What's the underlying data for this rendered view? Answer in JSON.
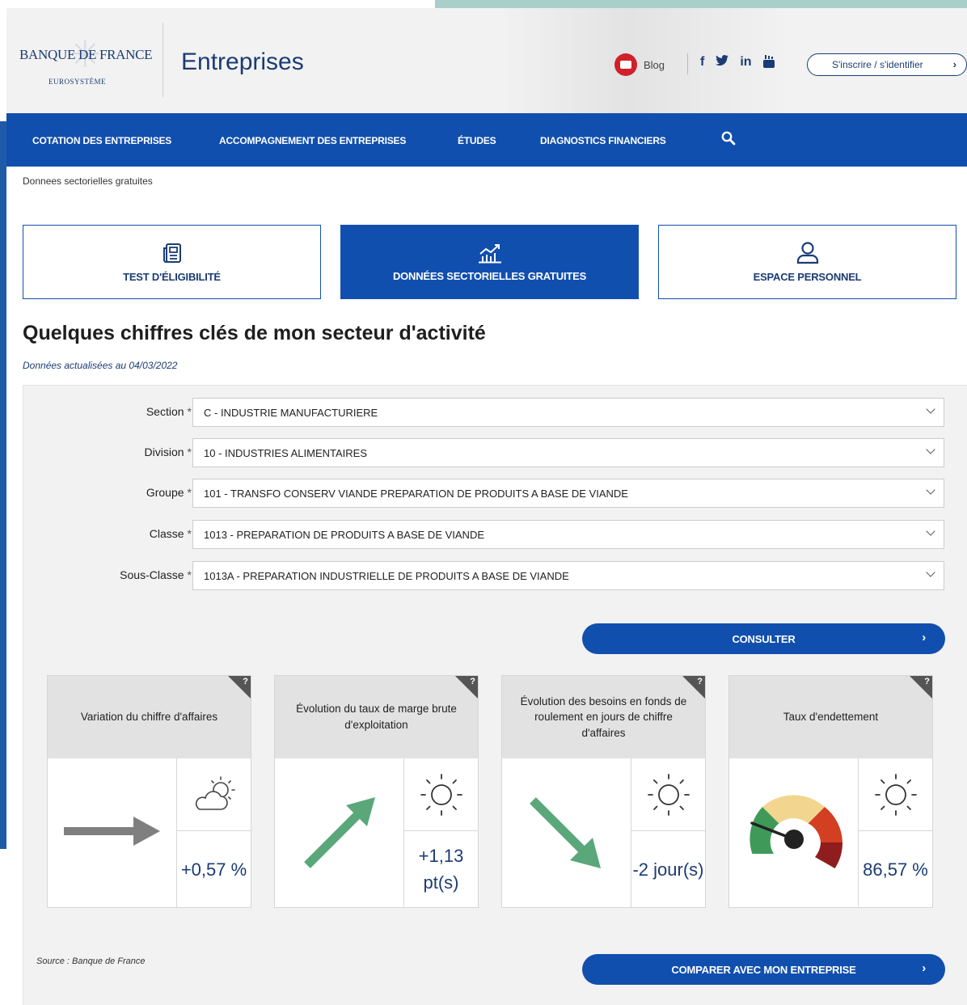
{
  "header": {
    "logo_main": "BANQUE DE FRANCE",
    "logo_sub": "EUROSYSTÈME",
    "site_title": "Entreprises",
    "blog_label": "Blog",
    "social": [
      "f",
      "y",
      "in",
      "yt"
    ],
    "login_label": "S'inscrire / s'identifier"
  },
  "nav": {
    "items": [
      "COTATION DES ENTREPRISES",
      "ACCOMPAGNEMENT DES ENTREPRISES",
      "ÉTUDES",
      "DIAGNOSTICS FINANCIERS"
    ]
  },
  "breadcrumb": "Donnees sectorielles gratuites",
  "tabs": [
    {
      "label": "TEST D'ÉLIGIBILITÉ",
      "icon": "document-icon",
      "active": false
    },
    {
      "label": "DONNÉES SECTORIELLES GRATUITES",
      "icon": "chart-icon",
      "active": true
    },
    {
      "label": "ESPACE PERSONNEL",
      "icon": "user-icon",
      "active": false
    }
  ],
  "page": {
    "title": "Quelques chiffres clés de mon secteur d'activité",
    "update_note": "Données actualisées au 04/03/2022"
  },
  "form": {
    "required_mark": "*",
    "fields": [
      {
        "label": "Section",
        "value": "C - INDUSTRIE MANUFACTURIERE"
      },
      {
        "label": "Division",
        "value": "10 - INDUSTRIES ALIMENTAIRES"
      },
      {
        "label": "Groupe",
        "value": "101 - TRANSFO CONSERV VIANDE PREPARATION DE PRODUITS A BASE DE VIANDE"
      },
      {
        "label": "Classe",
        "value": "1013 - PREPARATION DE PRODUITS A BASE DE VIANDE"
      },
      {
        "label": "Sous-Classe",
        "value": "1013A - PREPARATION INDUSTRIELLE DE PRODUITS A BASE DE VIANDE"
      }
    ],
    "consult_label": "CONSULTER"
  },
  "indicators": [
    {
      "title": "Variation du chiffre d'affaires",
      "value": "+0,57 %",
      "weather": "partly-cloudy-icon",
      "trend": "flat-arrow-icon"
    },
    {
      "title": "Évolution du taux de marge brute d'exploitation",
      "value": "+1,13 pt(s)",
      "weather": "sun-icon",
      "trend": "up-arrow-icon"
    },
    {
      "title": "Évolution des besoins en fonds de roulement en jours de chiffre d'affaires",
      "value": "-2 jour(s)",
      "weather": "sun-icon",
      "trend": "down-arrow-icon"
    },
    {
      "title": "Taux d'endettement",
      "value": "86,57 %",
      "weather": "sun-icon",
      "trend": "gauge-icon"
    }
  ],
  "help_mark": "?",
  "source": "Source : Banque de France",
  "compare_label": "COMPARER AVEC MON ENTREPRISE",
  "colors": {
    "brand_blue": "#114fae",
    "dark_blue": "#1b3c73",
    "green_arrow": "#5aa77a",
    "gray_arrow": "#7f7f7f",
    "gauge_green": "#3f9a5a",
    "gauge_yellow": "#f2d58e",
    "gauge_red": "#d23f22",
    "gauge_dark_red": "#8f1d1d"
  }
}
